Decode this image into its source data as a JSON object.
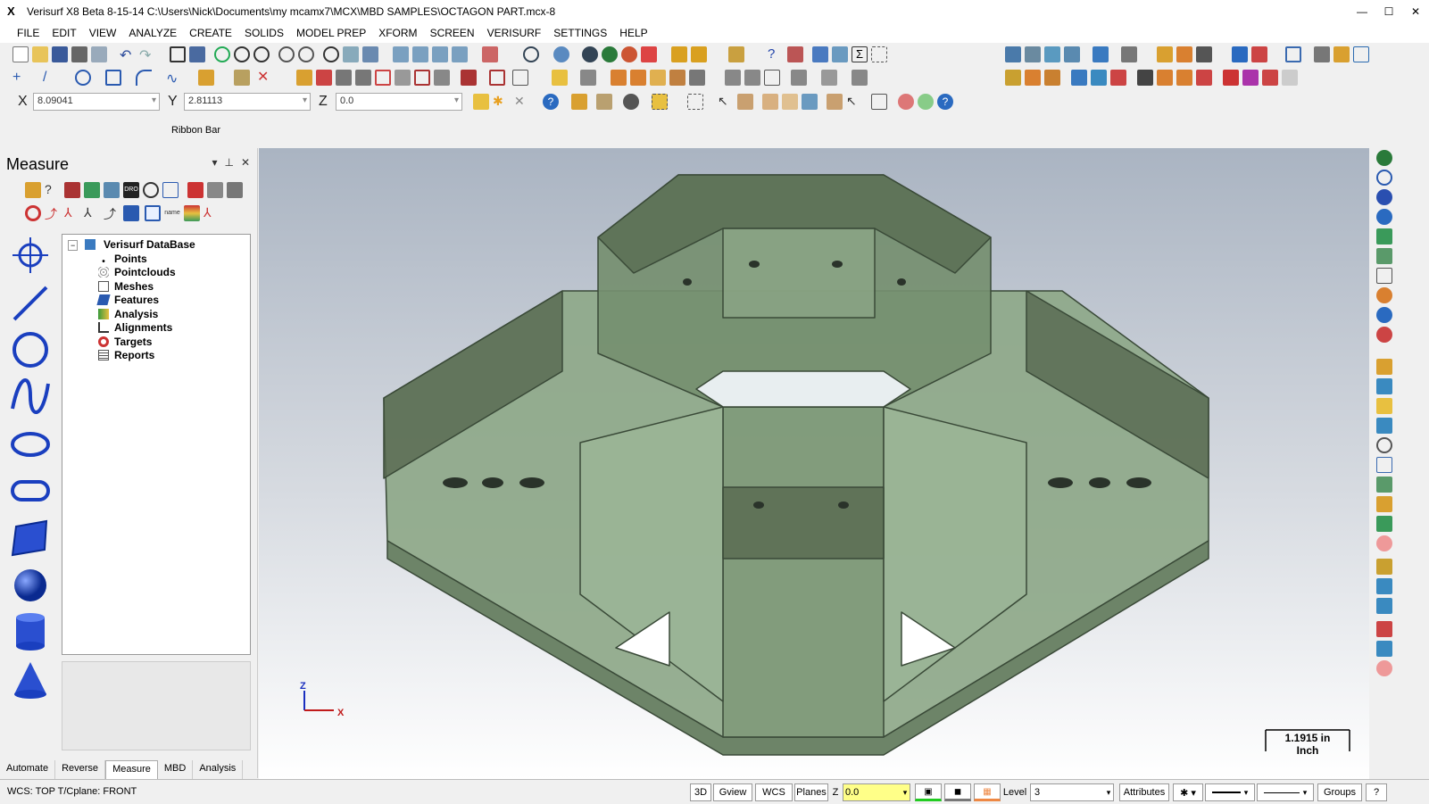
{
  "window": {
    "title": "Verisurf X8 Beta 8-15-14 C:\\Users\\Nick\\Documents\\my mcamx7\\MCX\\MBD SAMPLES\\OCTAGON PART.mcx-8",
    "controls": [
      "—",
      "☐",
      "✕"
    ]
  },
  "menu": [
    "FILE",
    "EDIT",
    "VIEW",
    "ANALYZE",
    "CREATE",
    "SOLIDS",
    "MODEL PREP",
    "XFORM",
    "SCREEN",
    "VERISURF",
    "SETTINGS",
    "HELP"
  ],
  "coords": {
    "x_label": "X",
    "x_value": "8.09041",
    "y_label": "Y",
    "y_value": "2.81113",
    "z_label": "Z",
    "z_value": "0.0"
  },
  "ribbon_label": "Ribbon Bar",
  "panel": {
    "title": "Measure",
    "controls": [
      "▾",
      "⊥",
      "✕"
    ],
    "tree": {
      "root": "Verisurf DataBase",
      "items": [
        {
          "label": "Points",
          "icon": "point-icon"
        },
        {
          "label": "Pointclouds",
          "icon": "pointcloud-icon"
        },
        {
          "label": "Meshes",
          "icon": "mesh-icon"
        },
        {
          "label": "Features",
          "icon": "features-icon"
        },
        {
          "label": "Analysis",
          "icon": "analysis-icon"
        },
        {
          "label": "Alignments",
          "icon": "alignments-icon"
        },
        {
          "label": "Targets",
          "icon": "targets-icon"
        },
        {
          "label": "Reports",
          "icon": "reports-icon"
        }
      ]
    },
    "tabs": [
      "Automate",
      "Reverse",
      "Measure",
      "MBD",
      "Analysis"
    ],
    "active_tab": "Measure"
  },
  "viewport": {
    "axis_z": "Z",
    "axis_x": "X",
    "scale_value": "1.1915 in",
    "scale_unit": "Inch"
  },
  "status": {
    "left": "WCS: TOP  T/Cplane: FRONT",
    "btn_3d": "3D",
    "btn_gview": "Gview",
    "btn_wcs": "WCS",
    "btn_planes": "Planes",
    "z_label": "Z",
    "z_value": "0.0",
    "level_label": "Level",
    "level_value": "3",
    "attributes": "Attributes",
    "groups": "Groups",
    "help": "?"
  },
  "colors": {
    "part_fill": "#7f9a7a",
    "part_edge": "#3a4a38",
    "accent_blue": "#1a3fbf"
  }
}
